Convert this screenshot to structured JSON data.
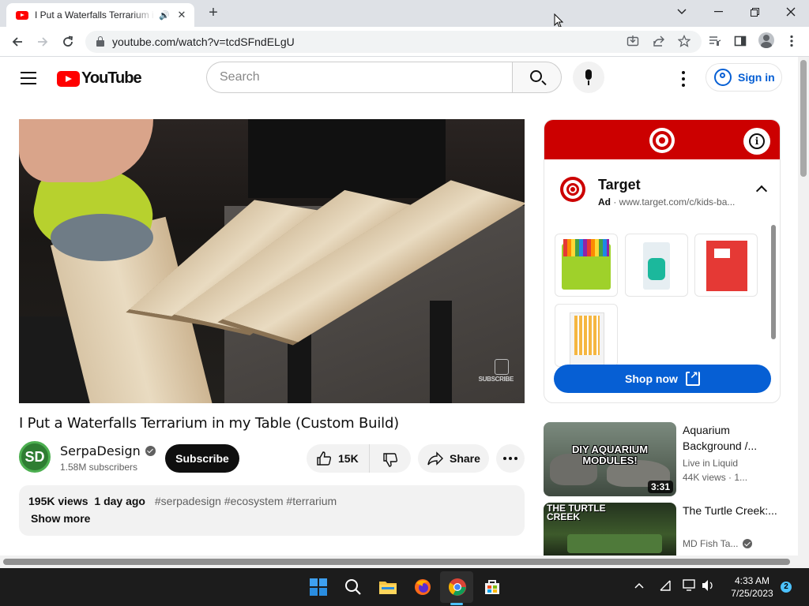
{
  "browser": {
    "tab_title": "I Put a Waterfalls Terrarium in",
    "new_tab_symbol": "+",
    "url": "youtube.com/watch?v=tcdSFndELgU",
    "window_controls": [
      "chevron-down-icon",
      "minimize-icon",
      "restore-icon",
      "close-icon"
    ],
    "omnibox_icons": [
      "install-icon",
      "share-icon",
      "bookmark-star-icon"
    ],
    "toolbar_icons": [
      "media-control-icon",
      "side-panel-icon",
      "profile-icon",
      "menu-icon"
    ]
  },
  "header": {
    "logo_text": "YouTube",
    "search_placeholder": "Search",
    "signin_label": "Sign in"
  },
  "video": {
    "title": "I Put a Waterfalls Terrarium in my Table (Custom Build)",
    "watermark_text": "SUBSCRIBE",
    "channel_initials": "SD",
    "channel_name": "SerpaDesign",
    "subscribers": "1.58M subscribers",
    "subscribe_label": "Subscribe",
    "likes": "15K",
    "share_label": "Share",
    "views": "195K views",
    "age": "1 day ago",
    "hashtags": "#serpadesign #ecosystem #terrarium",
    "show_more": "Show more"
  },
  "ad": {
    "brand": "Target",
    "badge": "Ad",
    "url": "www.target.com/c/kids-ba...",
    "cta": "Shop now",
    "colors": {
      "banner": "#cc0000",
      "button": "#065fd4"
    },
    "products": [
      "colored-pencils",
      "pencil-sharpener",
      "red-folder",
      "pencils"
    ]
  },
  "related": [
    {
      "title": "Aquarium Background /...",
      "channel": "Live in Liquid",
      "meta": "44K views · 1...",
      "duration": "3:31",
      "thumb_text": "DIY AQUARIUM MODULES!"
    },
    {
      "title": "The Turtle Creek:...",
      "channel": "MD Fish Ta...",
      "thumb_text": "THE TURTLE CREEK"
    }
  ],
  "taskbar": {
    "time": "4:33 AM",
    "date": "7/25/2023",
    "notifications": "2"
  }
}
